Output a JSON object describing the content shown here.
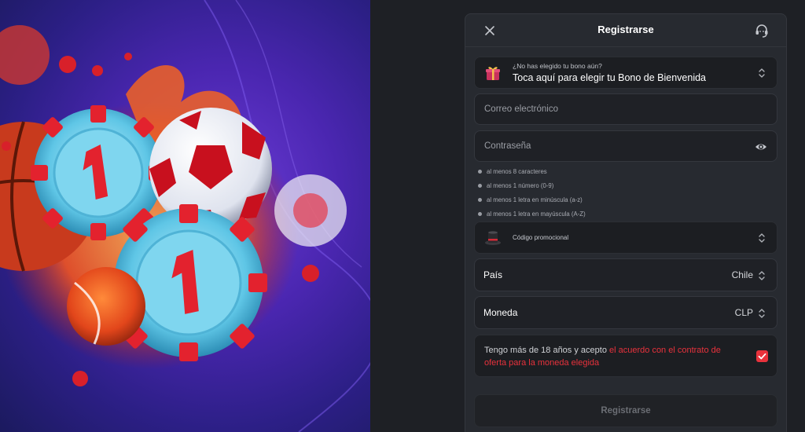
{
  "modal": {
    "title": "Registrarse",
    "close_icon": "close-icon",
    "support_icon": "headset-icon"
  },
  "bonus": {
    "question": "¿No has elegido tu bono aún?",
    "label": "Toca aquí para elegir tu Bono de Bienvenida",
    "icon": "gift-icon"
  },
  "email": {
    "placeholder": "Correo electrónico"
  },
  "password": {
    "placeholder": "Contraseña",
    "icon": "eye-icon"
  },
  "password_rules": [
    "al menos 8 caracteres",
    "al menos 1 número (0-9)",
    "al menos 1 letra en minúscula (a-z)",
    "al menos 1 letra en mayúscula (A-Z)"
  ],
  "promo_code": {
    "label": "Código promocional",
    "icon": "top-hat-icon"
  },
  "country": {
    "label": "País",
    "value": "Chile"
  },
  "currency": {
    "label": "Moneda",
    "value": "CLP"
  },
  "terms": {
    "text": "Tengo más de 18 años y acepto",
    "link": "el acuerdo con el contrato de oferta para la moneda elegida",
    "checked": true
  },
  "submit_label": "Registrarse",
  "colors": {
    "accent": "#e8323c",
    "modal_bg": "#272a30",
    "page_bg": "#1e2025",
    "promo_purple": "#4a26b0"
  }
}
